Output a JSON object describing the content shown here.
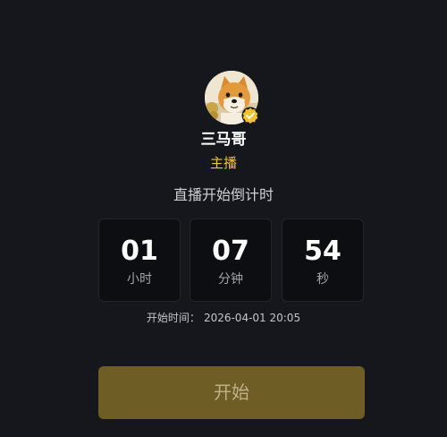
{
  "streamer": {
    "name": "三马哥",
    "role": "主播",
    "avatar_icon": "shiba-dog-avatar",
    "verified_icon": "verified-badge-icon"
  },
  "countdown": {
    "title": "直播开始倒计时",
    "hours": {
      "value": "01",
      "unit": "小时"
    },
    "minutes": {
      "value": "07",
      "unit": "分钟"
    },
    "seconds": {
      "value": "54",
      "unit": "秒"
    }
  },
  "start_time": {
    "label": "开始时间：",
    "value": "2026-04-01 20:05"
  },
  "start_button": {
    "label": "开始"
  },
  "colors": {
    "background": "#16171c",
    "accent": "#f3c22f",
    "button": "#6e5e25",
    "card": "#0d0e11"
  }
}
